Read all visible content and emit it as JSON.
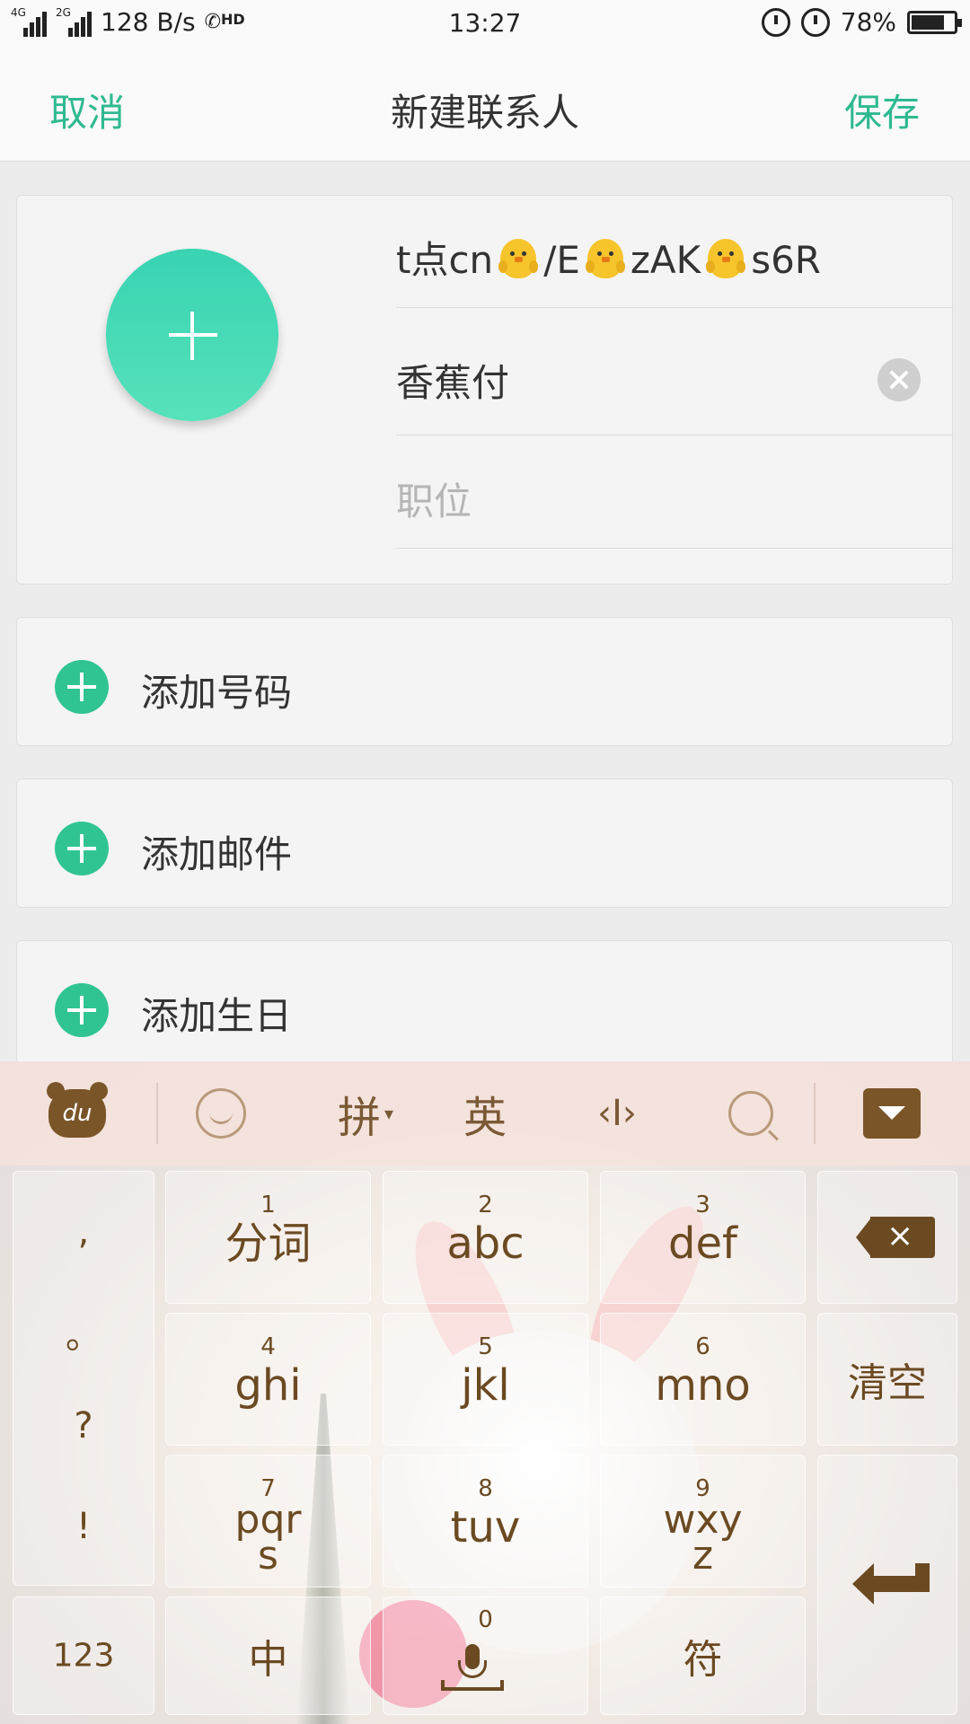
{
  "status_bar": {
    "network_1": "4G",
    "network_2": "2G",
    "speed": "128 B/s",
    "call_badge": "HD",
    "time": "13:27",
    "battery": "78%",
    "battery_level": 0.78
  },
  "title_bar": {
    "cancel_label": "取消",
    "title": "新建联系人",
    "save_label": "保存"
  },
  "contact": {
    "name_parts": [
      "t点cn",
      "/E",
      "zAK",
      "s6R"
    ],
    "name_emoji": "chick-emoji",
    "company": "香蕉付",
    "position_placeholder": "职位"
  },
  "add_rows": {
    "phone": "添加号码",
    "email": "添加邮件",
    "birthday": "添加生日"
  },
  "keyboard": {
    "toolbar": {
      "logo": "du",
      "pinyin": "拼",
      "english": "英",
      "cursor": "‹I›"
    },
    "punctuation": [
      ",",
      "。",
      "?",
      "!"
    ],
    "keys": [
      {
        "num": "1",
        "label": "分词"
      },
      {
        "num": "2",
        "label": "abc"
      },
      {
        "num": "3",
        "label": "def"
      },
      {
        "num": "4",
        "label": "ghi"
      },
      {
        "num": "5",
        "label": "jkl"
      },
      {
        "num": "6",
        "label": "mno"
      },
      {
        "num": "7",
        "label": "pqr\ns"
      },
      {
        "num": "8",
        "label": "tuv"
      },
      {
        "num": "9",
        "label": "wxy\nz"
      }
    ],
    "clear": "清空",
    "numbers": "123",
    "chinese": "中",
    "zero": "0",
    "symbols": "符"
  }
}
